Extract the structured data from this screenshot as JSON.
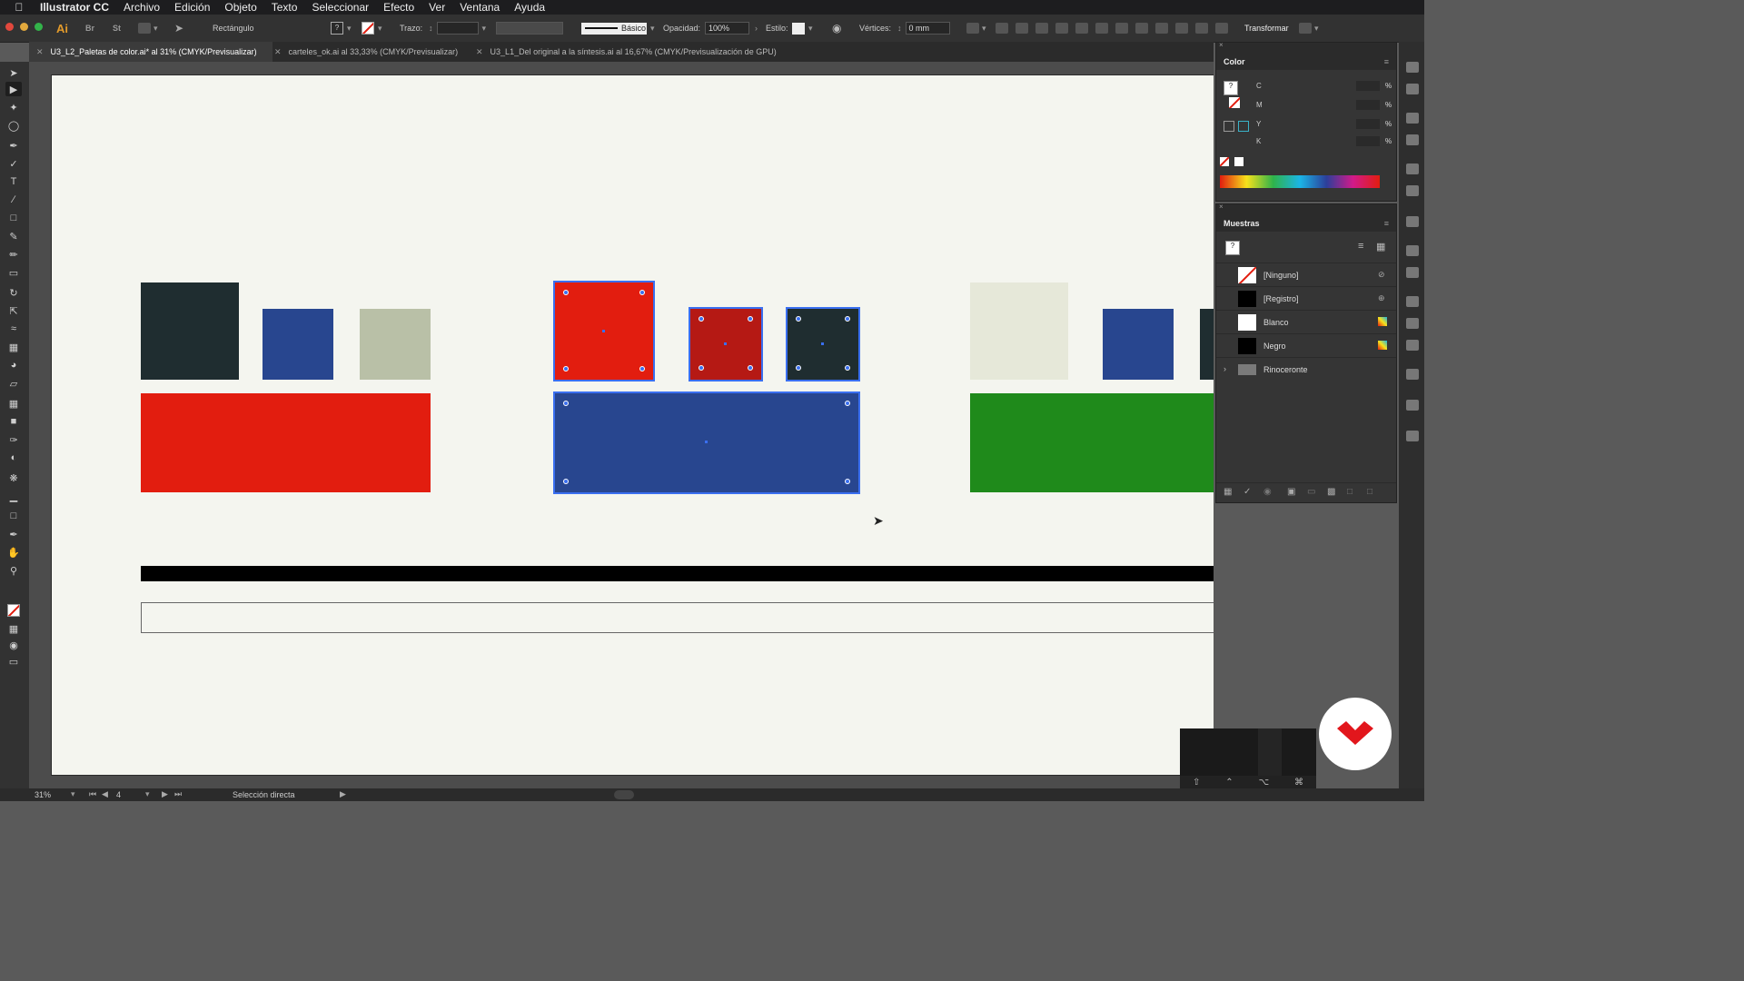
{
  "menubar": {
    "app_name": "Illustrator CC",
    "items": [
      "Archivo",
      "Edición",
      "Objeto",
      "Texto",
      "Seleccionar",
      "Efecto",
      "Ver",
      "Ventana",
      "Ayuda"
    ]
  },
  "controlbar": {
    "ai_logo": "Ai",
    "br_label": "Br",
    "st_label": "St",
    "object_type": "Rectángulo",
    "stroke_label": "Trazo:",
    "brush_label": "Básico",
    "opacity_label": "Opacidad:",
    "opacity_value": "100%",
    "style_label": "Estilo:",
    "vertices_label": "Vértices:",
    "vertices_value": "0 mm",
    "transform_label": "Transformar"
  },
  "tabs": [
    {
      "label": "U3_L2_Paletas de color.ai* al 31% (CMYK/Previsualizar)",
      "active": true
    },
    {
      "label": "carteles_ok.ai al 33,33% (CMYK/Previsualizar)",
      "active": false
    },
    {
      "label": "U3_L1_Del original a la síntesis.ai al 16,67% (CMYK/Previsualización de GPU)",
      "active": false
    }
  ],
  "color_panel": {
    "title": "Color",
    "channels": [
      "C",
      "M",
      "Y",
      "K"
    ],
    "percent_sign": "%"
  },
  "swatches_panel": {
    "title": "Muestras",
    "swatches": [
      {
        "label": "[Ninguno]",
        "color": "none"
      },
      {
        "label": "[Registro]",
        "color": "#000000"
      },
      {
        "label": "Blanco",
        "color": "#ffffff"
      },
      {
        "label": "Negro",
        "color": "#000000"
      },
      {
        "label": "Rinoceronte",
        "color": "folder"
      }
    ]
  },
  "statusbar": {
    "zoom": "31%",
    "artboard_number": "4",
    "tool_name": "Selección directa"
  },
  "colors": {
    "dark_teal": "#1f2d30",
    "blue": "#28468f",
    "sage": "#b9c0a7",
    "red": "#e21d0f",
    "dark_red": "#b51914",
    "cream": "#e6e8d9",
    "green": "#1f8a1b",
    "selection": "#3a6ff0",
    "logo_red": "#e2161c"
  }
}
